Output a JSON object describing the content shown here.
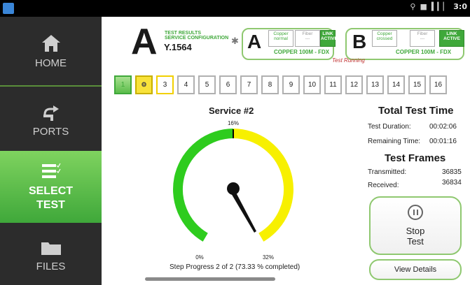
{
  "status_bar": {
    "time": "3:0"
  },
  "sidebar": {
    "items": [
      {
        "label": "HOME",
        "icon": "home-icon"
      },
      {
        "label": "PORTS",
        "icon": "ports-icon"
      },
      {
        "label_line1": "SELECT",
        "label_line2": "TEST",
        "icon": "select-test-icon",
        "active": true
      },
      {
        "label": "FILES",
        "icon": "folder-icon"
      }
    ]
  },
  "header": {
    "big_letter": "A",
    "results_line1": "TEST RESULTS",
    "results_line2": "SERVICE CONFIGURATION",
    "standard": "Y.1564",
    "port_a": {
      "letter": "A",
      "media1": "Copper",
      "media1_state": "normal",
      "media2": "Fiber",
      "media2_state": "---",
      "link_label": "LINK",
      "link_state": "ACTIVE",
      "speed": "COPPER 100M - FDX"
    },
    "port_b": {
      "letter": "B",
      "media1": "Copper",
      "media1_state": "crossed",
      "media2": "Fiber",
      "media2_state": "---",
      "link_label": "LINK",
      "link_state": "ACTIVE",
      "speed": "COPPER 100M - FDX"
    },
    "test_status": "Test Running"
  },
  "steps": [
    "1",
    "2",
    "3",
    "4",
    "5",
    "6",
    "7",
    "8",
    "9",
    "10",
    "11",
    "12",
    "13",
    "14",
    "15",
    "16"
  ],
  "gauge": {
    "title": "Service #2",
    "top_label": "16%",
    "min_label": "0%",
    "max_label": "32%",
    "colors": {
      "low": "#2ecc1e",
      "high": "#f7f000"
    }
  },
  "progress": {
    "text": "Step Progress 2 of 2 (73.33 % completed)",
    "percent": 73.33
  },
  "total_time": {
    "title": "Total Test Time",
    "duration_label": "Test Duration:",
    "duration_value": "00:02:06",
    "remaining_label": "Remaining Time:",
    "remaining_value": "00:01:16"
  },
  "frames": {
    "title": "Test Frames",
    "transmitted_label": "Transmitted:",
    "transmitted_value": "36835",
    "received_label": "Received:",
    "received_value": "36834"
  },
  "buttons": {
    "stop_line1": "Stop",
    "stop_line2": "Test",
    "view_details": "View Details"
  },
  "accent": "#3fa83a"
}
